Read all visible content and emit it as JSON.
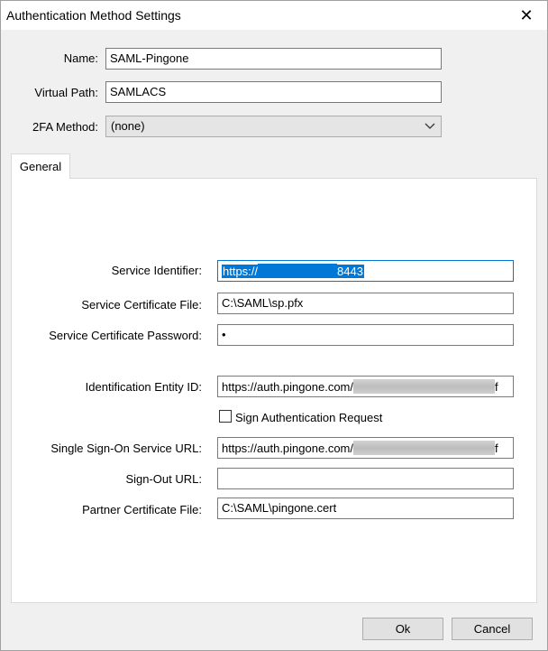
{
  "window": {
    "title": "Authentication Method Settings",
    "close_glyph": "✕"
  },
  "form": {
    "name_label": "Name:",
    "name_value": "SAML-Pingone",
    "virtual_path_label": "Virtual Path:",
    "virtual_path_value": "SAMLACS",
    "twofa_label": "2FA Method:",
    "twofa_value": "(none)"
  },
  "tabs": [
    {
      "label": "General",
      "selected": true
    }
  ],
  "general": {
    "service_identifier_label": "Service Identifier:",
    "service_identifier_prefix": "https://",
    "service_identifier_suffix": "8443",
    "service_cert_file_label": "Service Certificate File:",
    "service_cert_file_value": "C:\\SAML\\sp.pfx",
    "service_cert_password_label": "Service Certificate Password:",
    "service_cert_password_value": "•",
    "identification_entity_label": "Identification Entity ID:",
    "identification_entity_prefix": "https://auth.pingone.com/",
    "identification_entity_suffix": "f",
    "sign_auth_request_label": "Sign Authentication Request",
    "sign_auth_request_checked": false,
    "sso_url_label": "Single Sign-On Service URL:",
    "sso_url_prefix": "https://auth.pingone.com/",
    "sso_url_suffix": "f",
    "signout_url_label": "Sign-Out URL:",
    "signout_url_value": "",
    "partner_cert_label": "Partner Certificate File:",
    "partner_cert_value": "C:\\SAML\\pingone.cert"
  },
  "buttons": {
    "ok_label": "Ok",
    "cancel_label": "Cancel"
  },
  "colors": {
    "selection": "#0078d7",
    "focus_border": "#0078d7",
    "dialog_bg": "#f0f0f0"
  }
}
